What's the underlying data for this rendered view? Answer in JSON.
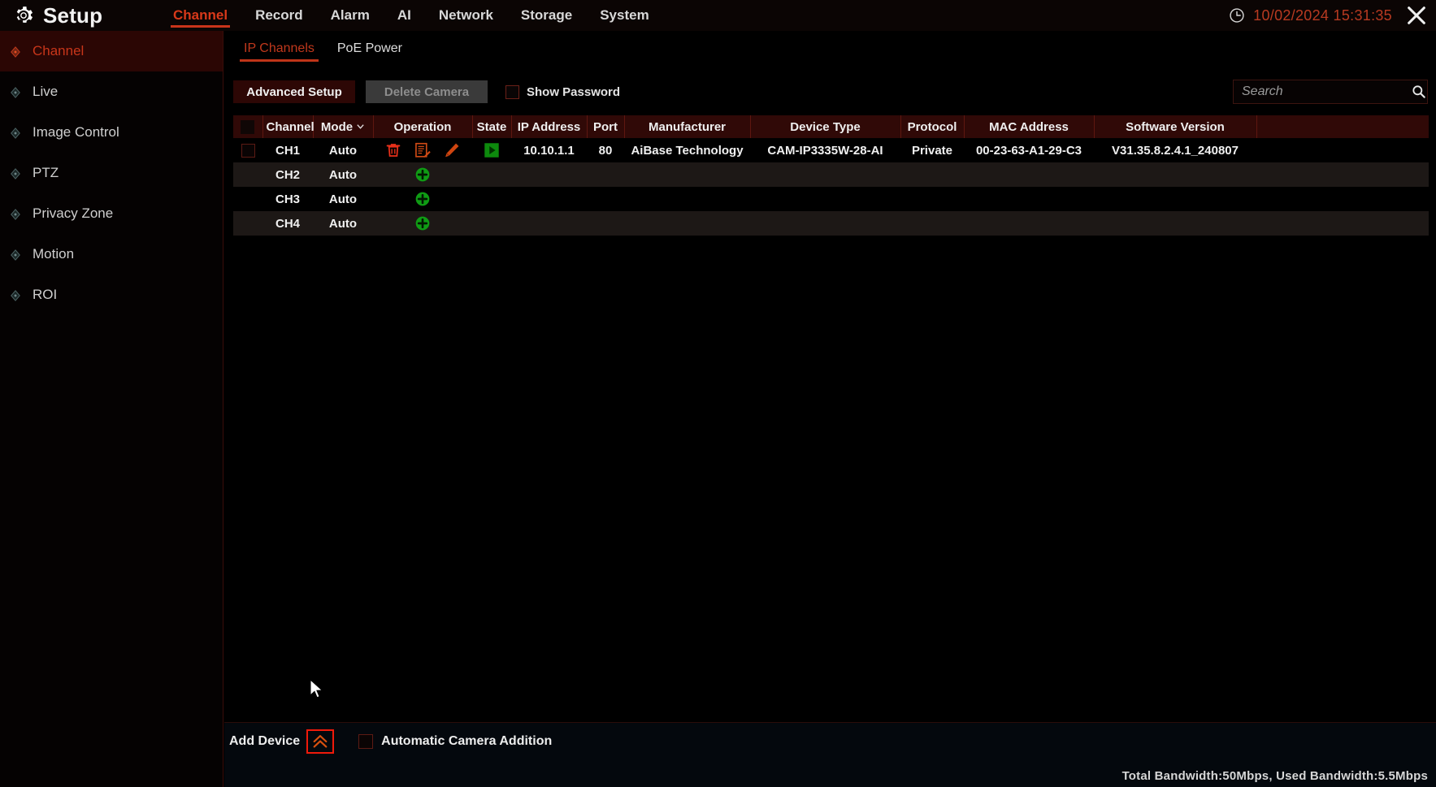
{
  "header": {
    "brand_title": "Setup",
    "gear_icon": "gear-icon",
    "clock_icon": "clock-icon",
    "datetime": "10/02/2024 15:31:35",
    "close_icon": "close-icon",
    "nav": [
      {
        "label": "Channel",
        "active": true
      },
      {
        "label": "Record",
        "active": false
      },
      {
        "label": "Alarm",
        "active": false
      },
      {
        "label": "AI",
        "active": false
      },
      {
        "label": "Network",
        "active": false
      },
      {
        "label": "Storage",
        "active": false
      },
      {
        "label": "System",
        "active": false
      }
    ]
  },
  "sidebar": {
    "items": [
      {
        "label": "Channel",
        "active": true
      },
      {
        "label": "Live",
        "active": false
      },
      {
        "label": "Image Control",
        "active": false
      },
      {
        "label": "PTZ",
        "active": false
      },
      {
        "label": "Privacy Zone",
        "active": false
      },
      {
        "label": "Motion",
        "active": false
      },
      {
        "label": "ROI",
        "active": false
      }
    ]
  },
  "tabs": [
    {
      "label": "IP Channels",
      "active": true
    },
    {
      "label": "PoE Power",
      "active": false
    }
  ],
  "toolbar": {
    "advanced_setup_label": "Advanced Setup",
    "delete_camera_label": "Delete Camera",
    "show_password_label": "Show Password",
    "show_password_checked": false,
    "search_placeholder": "Search",
    "search_value": "",
    "search_icon": "search-icon"
  },
  "table": {
    "columns": [
      "",
      "Channel",
      "Mode",
      "Operation",
      "State",
      "IP Address",
      "Port",
      "Manufacturer",
      "Device Type",
      "Protocol",
      "MAC Address",
      "Software Version",
      ""
    ],
    "mode_sort_icon": "chevron-down-icon",
    "rows": [
      {
        "channel": "CH1",
        "mode": "Auto",
        "operation_icons": [
          "delete-icon",
          "edit-params-icon",
          "edit-pencil-icon"
        ],
        "state_icon": "play-icon",
        "ip_address": "10.10.1.1",
        "port": "80",
        "manufacturer": "AiBase Technology",
        "device_type": "CAM-IP3335W-28-AI",
        "protocol": "Private",
        "mac_address": "00-23-63-A1-29-C3",
        "software_version": "V31.35.8.2.4.1_240807",
        "has_camera": true,
        "checked": false
      },
      {
        "channel": "CH2",
        "mode": "Auto",
        "operation_icons": [
          "add-camera-icon"
        ],
        "state_icon": "",
        "ip_address": "",
        "port": "",
        "manufacturer": "",
        "device_type": "",
        "protocol": "",
        "mac_address": "",
        "software_version": "",
        "has_camera": false,
        "checked": false
      },
      {
        "channel": "CH3",
        "mode": "Auto",
        "operation_icons": [
          "add-camera-icon"
        ],
        "state_icon": "",
        "ip_address": "",
        "port": "",
        "manufacturer": "",
        "device_type": "",
        "protocol": "",
        "mac_address": "",
        "software_version": "",
        "has_camera": false,
        "checked": false
      },
      {
        "channel": "CH4",
        "mode": "Auto",
        "operation_icons": [
          "add-camera-icon"
        ],
        "state_icon": "",
        "ip_address": "",
        "port": "",
        "manufacturer": "",
        "device_type": "",
        "protocol": "",
        "mac_address": "",
        "software_version": "",
        "has_camera": false,
        "checked": false
      }
    ]
  },
  "footer": {
    "add_device_label": "Add Device",
    "add_device_icon": "chevron-double-up-icon",
    "automatic_camera_addition_label": "Automatic Camera Addition",
    "automatic_camera_addition_checked": false,
    "bandwidth_status": "Total Bandwidth:50Mbps, Used Bandwidth:5.5Mbps"
  },
  "colors": {
    "accent_red": "#c8341a",
    "header_maroon": "#300907",
    "sidebar_active": "#2b0604",
    "green_state": "#119411",
    "highlight_box": "#f01a0a"
  }
}
